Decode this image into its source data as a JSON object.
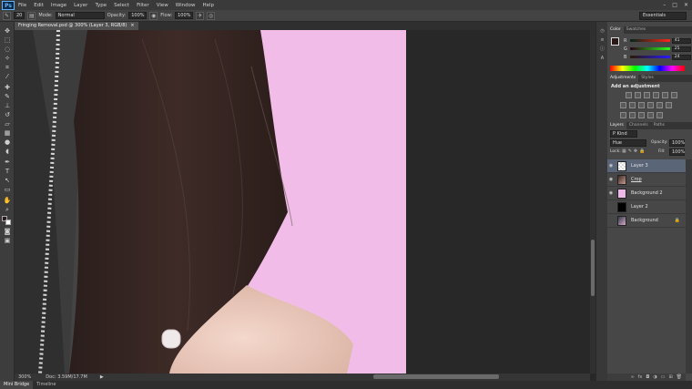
{
  "app": {
    "logo": "Ps",
    "workspace": "Essentials"
  },
  "menu": [
    "File",
    "Edit",
    "Image",
    "Layer",
    "Type",
    "Select",
    "Filter",
    "View",
    "Window",
    "Help"
  ],
  "window_controls": {
    "minimize": "–",
    "restore": "□",
    "close": "✕"
  },
  "options_bar": {
    "brush_size": "20",
    "mode_label": "Mode:",
    "mode_value": "Normal",
    "opacity_label": "Opacity:",
    "opacity_value": "100%",
    "flow_label": "Flow:",
    "flow_value": "100%"
  },
  "document": {
    "tab_title": "Fringing Removal.psd @ 300% (Layer 3, RGB/8)",
    "close": "×"
  },
  "status": {
    "zoom": "300%",
    "doc_info": "Doc: 3.59M/17.7M"
  },
  "bottom_tabs": [
    {
      "label": "Mini Bridge",
      "active": true
    },
    {
      "label": "Timeline",
      "active": false
    }
  ],
  "color_panel": {
    "tabs": [
      "Color",
      "Swatches"
    ],
    "channels": [
      {
        "label": "R",
        "value": "41",
        "track": "linear-gradient(to right,#002519,#ff2519)"
      },
      {
        "label": "G",
        "value": "25",
        "track": "linear-gradient(to right,#290019,#29ff19)"
      },
      {
        "label": "B",
        "value": "24",
        "track": "linear-gradient(to right,#291900,#2919ff)"
      }
    ],
    "fg": "#291918",
    "bg": "#ffffff"
  },
  "adjustments_panel": {
    "tabs": [
      "Adjustments",
      "Styles"
    ],
    "heading": "Add an adjustment"
  },
  "layers_panel": {
    "tabs": [
      "Layers",
      "Channels",
      "Paths"
    ],
    "filter_label": "P Kind",
    "blend_mode": "Hue",
    "opacity_label": "Opacity:",
    "opacity_value": "100%",
    "lock_label": "Lock:",
    "fill_label": "Fill:",
    "fill_value": "100%",
    "layers": [
      {
        "name": "Layer 3",
        "selected": true,
        "visible": true,
        "thumb": "transparent",
        "locked": false
      },
      {
        "name": "Crop",
        "selected": false,
        "visible": true,
        "thumb": "photo",
        "locked": false
      },
      {
        "name": "Background 2",
        "selected": false,
        "visible": true,
        "thumb": "#f0b8e6",
        "locked": false
      },
      {
        "name": "Layer 2",
        "selected": false,
        "visible": false,
        "thumb": "#000000",
        "locked": false
      },
      {
        "name": "Background",
        "selected": false,
        "visible": false,
        "thumb": "photo",
        "locked": true
      }
    ]
  },
  "colors": {
    "pink_backdrop": "#f1bde8",
    "selection": "#5a6578"
  }
}
